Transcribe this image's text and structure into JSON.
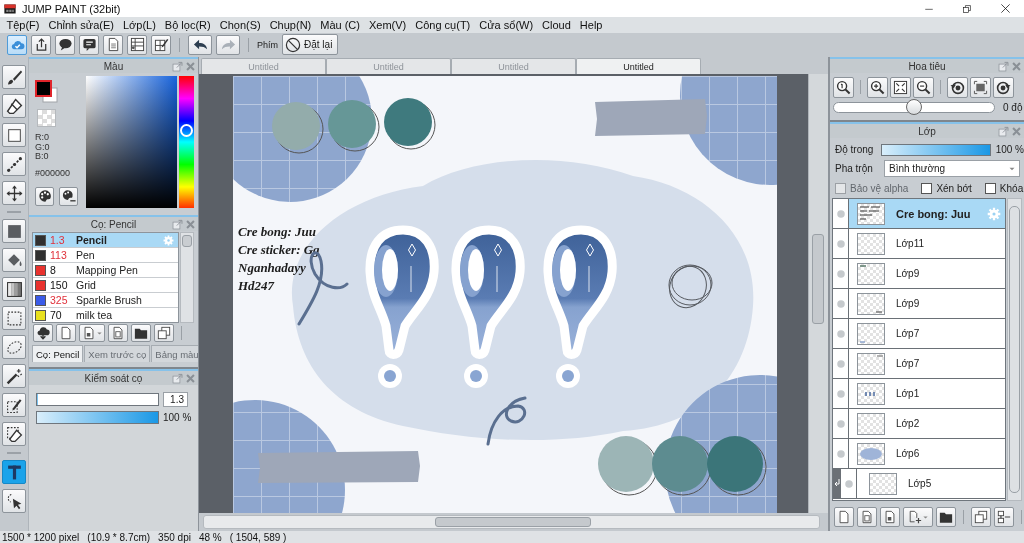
{
  "window": {
    "title": "JUMP PAINT (32bit)"
  },
  "menu": [
    "Tệp(F)",
    "Chỉnh sửa(E)",
    "Lớp(L)",
    "Bộ lọc(R)",
    "Chọn(S)",
    "Chụp(N)",
    "Màu (C)",
    "Xem(V)",
    "Công cụ(T)",
    "Cửa sổ(W)",
    "Cloud",
    "Help"
  ],
  "toolbar": {
    "groups": [
      [
        {
          "kind": "cloud-sync",
          "on": true,
          "disabled": false
        },
        {
          "kind": "upload",
          "on": false,
          "disabled": false
        },
        {
          "kind": "speech-bubble",
          "on": false,
          "disabled": false
        },
        {
          "kind": "message",
          "on": false,
          "disabled": false
        },
        {
          "kind": "page",
          "on": false,
          "disabled": false
        },
        {
          "kind": "list",
          "on": false,
          "disabled": false
        },
        {
          "kind": "grid-pencil",
          "on": false,
          "disabled": false
        }
      ],
      [
        {
          "kind": "undo",
          "on": false,
          "disabled": false
        },
        {
          "kind": "redo",
          "on": false,
          "disabled": true
        }
      ]
    ],
    "key_label": "Phím",
    "reset_button": "Đặt lại"
  },
  "tools": {
    "groups": [
      [
        {
          "kind": "brush",
          "selected": false
        },
        {
          "kind": "eraser",
          "selected": false
        },
        {
          "kind": "square",
          "selected": false
        },
        {
          "kind": "dotted-line",
          "selected": false
        },
        {
          "kind": "move",
          "selected": false
        }
      ],
      [
        {
          "kind": "fill",
          "selected": false
        },
        {
          "kind": "bucket",
          "selected": false
        },
        {
          "kind": "gradient",
          "selected": false
        },
        {
          "kind": "rect-select",
          "selected": false
        },
        {
          "kind": "lasso",
          "selected": false
        },
        {
          "kind": "wand",
          "selected": false
        },
        {
          "kind": "select-pen",
          "selected": false
        },
        {
          "kind": "select-eraser",
          "selected": false
        }
      ],
      [
        {
          "kind": "text",
          "selected": true
        },
        {
          "kind": "select-arrow",
          "selected": false
        }
      ]
    ]
  },
  "color_panel": {
    "title": "Màu",
    "rgb": [
      "R:0",
      "G:0",
      "B:0"
    ],
    "hex": "#000000",
    "hue_slider": {
      "level": 0.59
    }
  },
  "brush_panel": {
    "title": "Cọ: Pencil",
    "brushes": [
      {
        "color": "#303030",
        "size": "1.3",
        "size_emphasized": true,
        "name": "Pencil",
        "selected": true
      },
      {
        "color": "#303030",
        "size": "113",
        "size_emphasized": true,
        "name": "Pen",
        "selected": false
      },
      {
        "color": "#e8322e",
        "size": "8",
        "size_emphasized": false,
        "name": "Mapping Pen",
        "selected": false
      },
      {
        "color": "#e8322e",
        "size": "150",
        "size_emphasized": false,
        "name": "Grid",
        "selected": false
      },
      {
        "color": "#3a5be8",
        "size": "325",
        "size_emphasized": true,
        "name": "Sparkle Brush",
        "selected": false
      },
      {
        "color": "#e8e01e",
        "size": "70",
        "size_emphasized": false,
        "name": "milk tea",
        "selected": false
      }
    ],
    "tabs": [
      {
        "label": "Cọ: Pencil",
        "selected": true,
        "disabled": false
      },
      {
        "label": "Xem trước cọ",
        "selected": false,
        "disabled": true
      },
      {
        "label": "Bảng màu",
        "selected": false,
        "disabled": true
      }
    ]
  },
  "brush_control": {
    "title": "Kiểm soát cọ",
    "size_slider": {
      "level": 0.01,
      "value": "1.3"
    },
    "density_slider": {
      "level": 1.0,
      "value": "100 %"
    }
  },
  "document_tabs": [
    {
      "label": "Untitled",
      "selected": false
    },
    {
      "label": "Untitled",
      "selected": false
    },
    {
      "label": "Untitled",
      "selected": false
    },
    {
      "label": "Untitled",
      "selected": true
    }
  ],
  "canvas": {
    "text_lines": [
      "Cre bong: Juu",
      "Cre sticker: Gg",
      "Nganhadayy",
      "Hd247"
    ]
  },
  "navigator": {
    "title": "Hoa tiêu",
    "rotation_slider": {
      "level": 0.5,
      "value": "0 độ"
    }
  },
  "layers_panel": {
    "title": "Lớp",
    "opacity": {
      "label": "Độ trong",
      "level": 1.0,
      "value": "100 %"
    },
    "blend_mode": {
      "label": "Pha trộn",
      "value": "Bình thường"
    },
    "options": [
      {
        "label": "Bảo vệ alpha",
        "checked": false,
        "disabled": true
      },
      {
        "label": "Xén bớt",
        "checked": false,
        "disabled": false
      },
      {
        "label": "Khóa",
        "checked": false,
        "disabled": false
      }
    ],
    "layers": [
      {
        "name": "Cre bong: Juu",
        "kind": "text",
        "selected": true,
        "clipped": false
      },
      {
        "name": "Lớp11",
        "kind": "blank",
        "selected": false,
        "clipped": false
      },
      {
        "name": "Lớp9",
        "kind": "mark-top-left",
        "selected": false,
        "clipped": false
      },
      {
        "name": "Lớp9",
        "kind": "mark-bottom-right",
        "selected": false,
        "clipped": false
      },
      {
        "name": "Lớp7",
        "kind": "mark-bottom-left",
        "selected": false,
        "clipped": false
      },
      {
        "name": "Lớp7",
        "kind": "mark-top-right",
        "selected": false,
        "clipped": false
      },
      {
        "name": "Lớp1",
        "kind": "question-marks",
        "selected": false,
        "clipped": false
      },
      {
        "name": "Lớp2",
        "kind": "blank",
        "selected": false,
        "clipped": false
      },
      {
        "name": "Lớp6",
        "kind": "blob",
        "selected": false,
        "clipped": false
      },
      {
        "name": "Lớp5",
        "kind": "blank",
        "selected": false,
        "clipped": true
      }
    ]
  },
  "status_bar": [
    "1500 * 1200 pixel",
    "(10.9 * 8.7cm)",
    "350 dpi",
    "48 %",
    "( 1504, 589 )"
  ]
}
